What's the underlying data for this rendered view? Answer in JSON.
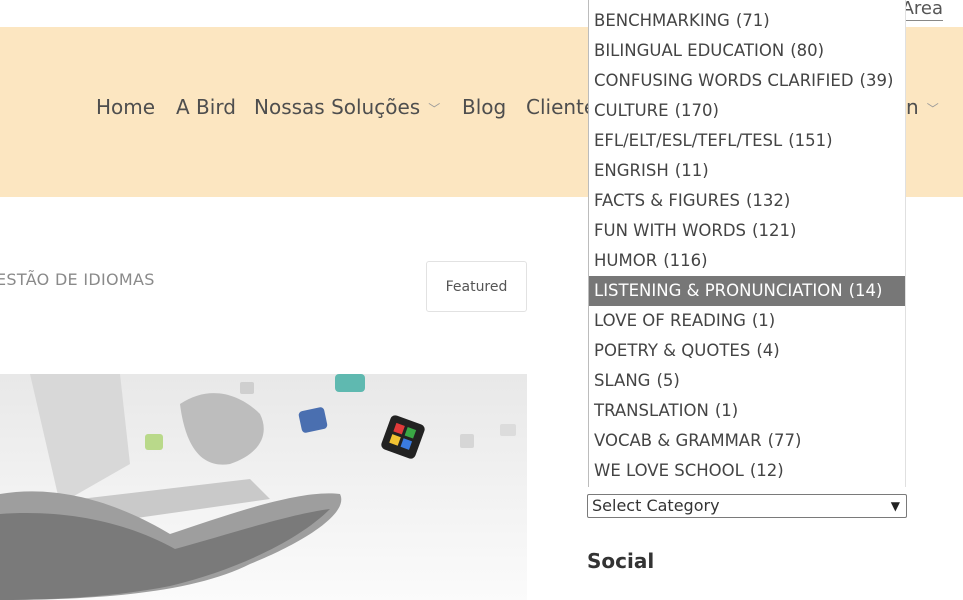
{
  "header": {
    "area_link": "Area"
  },
  "nav": {
    "items": [
      {
        "label": "Home"
      },
      {
        "label": "A Bird"
      },
      {
        "label": "Nossas Soluções"
      },
      {
        "label": "Blog"
      },
      {
        "label": "Cliente"
      }
    ],
    "hidden_tail": "n"
  },
  "main": {
    "breadcrumb": "ESTÃO DE IDIOMAS",
    "featured_label": "Featured"
  },
  "category_dropdown": {
    "options": [
      {
        "label": "BENCHMARKING",
        "count": "(71)"
      },
      {
        "label": "BILINGUAL EDUCATION",
        "count": "(80)"
      },
      {
        "label": "CONFUSING WORDS CLARIFIED",
        "count": "(39)"
      },
      {
        "label": "CULTURE",
        "count": "(170)"
      },
      {
        "label": "EFL/ELT/ESL/TEFL/TESL",
        "count": "(151)"
      },
      {
        "label": "ENGRISH",
        "count": "(11)"
      },
      {
        "label": "FACTS & FIGURES",
        "count": "(132)"
      },
      {
        "label": "FUN WITH WORDS",
        "count": "(121)"
      },
      {
        "label": "HUMOR",
        "count": "(116)"
      },
      {
        "label": "LISTENING & PRONUNCIATION",
        "count": "(14)"
      },
      {
        "label": "LOVE OF READING",
        "count": "(1)"
      },
      {
        "label": "POETRY & QUOTES",
        "count": "(4)"
      },
      {
        "label": "SLANG",
        "count": "(5)"
      },
      {
        "label": "TRANSLATION",
        "count": "(1)"
      },
      {
        "label": "VOCAB & GRAMMAR",
        "count": "(77)"
      },
      {
        "label": "WE LOVE SCHOOL",
        "count": "(12)"
      }
    ],
    "highlighted": "LISTENING & PRONUNCIATION",
    "select_value": "Select Category"
  },
  "sidebar": {
    "social_heading": "Social"
  },
  "colors": {
    "nav_band": "#fce6c1",
    "highlight": "#777777"
  }
}
